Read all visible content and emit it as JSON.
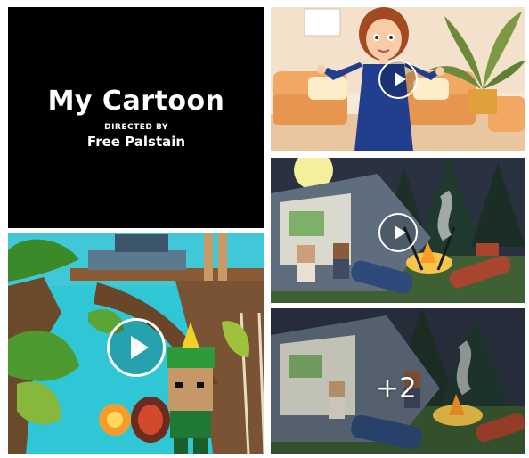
{
  "title_card": {
    "title": "My Cartoon",
    "directed_by": "DIRECTED BY",
    "director": "Free Palstain"
  },
  "more_overlay": {
    "label": "+2"
  },
  "icons": {
    "play": "play-icon"
  },
  "colors": {
    "title_background": "#000000",
    "play_button": "#ffffff"
  }
}
